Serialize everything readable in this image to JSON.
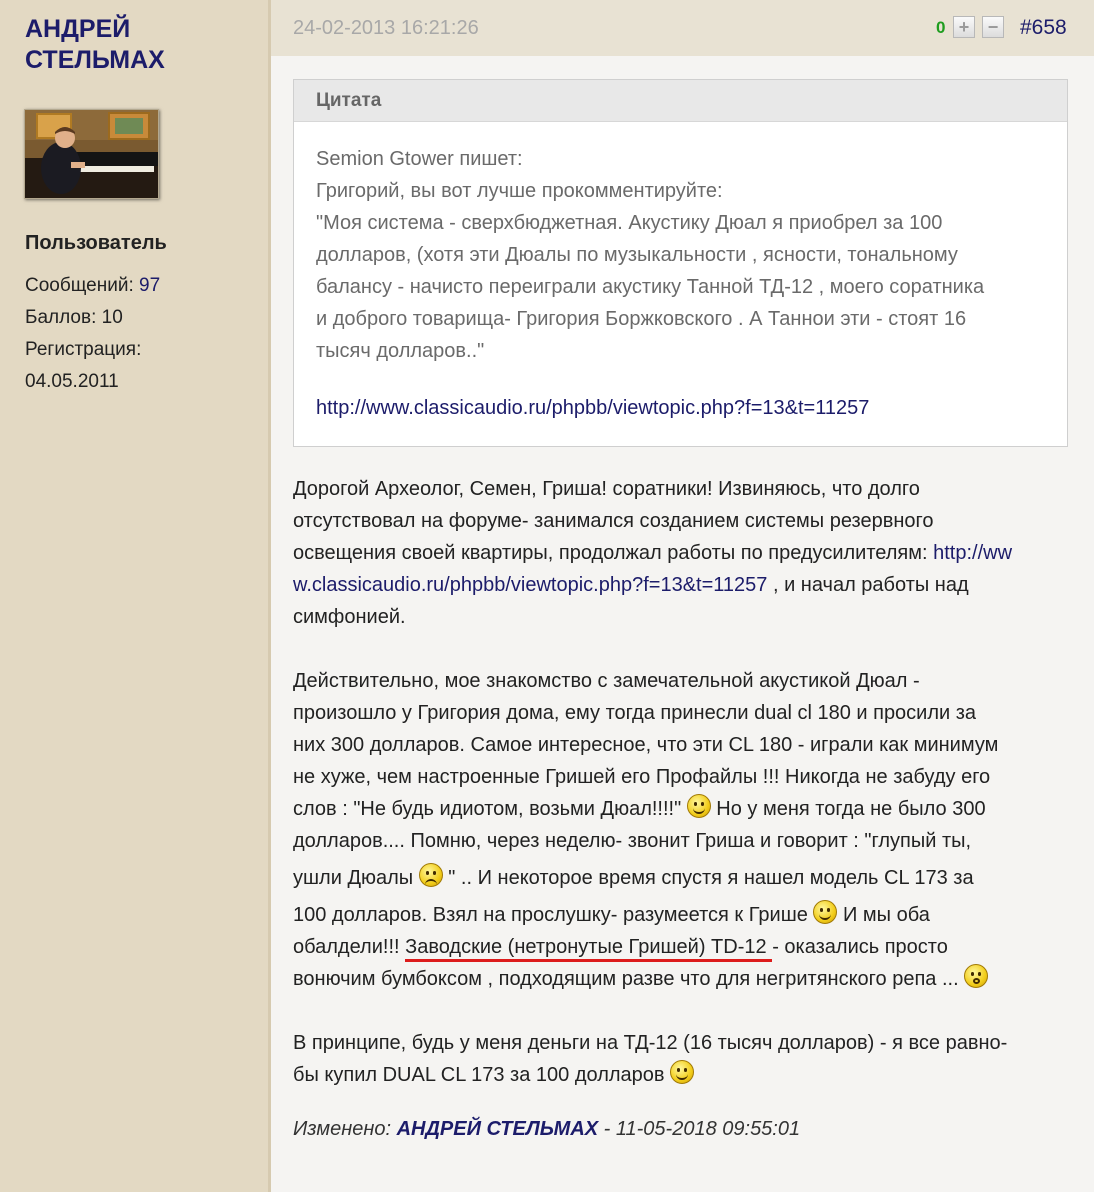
{
  "user": {
    "name_line1": "АНДРЕЙ",
    "name_line2": "СТЕЛЬМАХ",
    "role": "Пользователь",
    "messages_label": "Сообщений:",
    "messages_count": "97",
    "points_label": "Баллов:",
    "points_value": "10",
    "registration_label": "Регистрация:",
    "registration_date": "04.05.2011"
  },
  "post": {
    "date": "24-02-2013 16:21:26",
    "rating": "0",
    "plus_label": "+",
    "minus_label": "−",
    "number": "#658"
  },
  "quote": {
    "title": "Цитата",
    "lines": [
      "Semion Gtower пишет:",
      "Григорий, вы вот лучше прокомментируйте:",
      "\"Моя система - сверхбюджетная. Акустику Дюал я приобрел за 100",
      "долларов, (хотя эти Дюалы по музыкальности , ясности, тональному",
      "балансу - начисто переиграли акустику Танной ТД-12 , моего соратника",
      "и доброго товарища- Григория Боржковского . А Таннои эти - стоят 16",
      "тысяч долларов..\""
    ],
    "link": "http://www.classicaudio.ru/phpbb/viewtopic.php?f=13&t=11257"
  },
  "body": {
    "p1_line1": "Дорогой Археолог, Семен, Гриша! соратники! Извиняюсь, что долго",
    "p1_line2": "отсутствовал на форуме- занимался созданием системы резервного",
    "p1_line3_text": "освещения своей квартиры, продолжал работы по предусилителям: ",
    "p1_link_part1": "http://ww",
    "p1_link_part2": "w.classicaudio.ru/phpbb/viewtopic.php?f=13&t=11257",
    "p1_line4_rest": " , и начал работы над",
    "p1_line5": "симфонией.",
    "p2_line1": "Действительно, мое знакомство с замечательной акустикой Дюал -",
    "p2_line2": "произошло у Григория дома, ему тогда принесли dual cl 180 и просили за",
    "p2_line3": "них 300 долларов.  Самое интересное, что эти  CL 180 - играли как минимум",
    "p2_line4": "не хуже, чем настроенные Гришей  его Профайлы !!!  Никогда не забуду его",
    "p2_line5a": "слов : \"Не будь идиотом, возьми Дюал!!!!\" ",
    "p2_line5b": " Но у меня тогда не было 300",
    "p2_line6": "долларов.... Помню, через неделю- звонит Гриша и говорит : \"глупый ты,",
    "p2_line7a": "ушли Дюалы ",
    "p2_line7b": "   \" ..  И некоторое время спустя я нашел модель CL 173 за",
    "p2_line8a": "100 долларов. Взял на прослушку- разумеется к Грише ",
    "p2_line8b": " И мы оба",
    "p2_line9a": "обалдели!!!  ",
    "p2_line9_underlined": "Заводские (нетронутые Гришей) TD-12 ",
    "p2_line9b": "- оказались просто",
    "p2_line10": "вонючим бумбоксом , подходящим разве что для негритянского репа ... ",
    "p3_line1": "В принципе, будь у меня деньги на ТД-12  (16 тысяч долларов) - я все равно-",
    "p3_line2": "бы купил DUAL CL 173 за 100 долларов "
  },
  "edited": {
    "label": "Изменено: ",
    "author": "АНДРЕЙ СТЕЛЬМАХ",
    "datetime": " - 11-05-2018 09:55:01"
  },
  "icons": {
    "smiley_grin": "grin-smiley-icon",
    "smiley_sad": "sad-smiley-icon",
    "smiley_wink": "wink-smiley-icon",
    "smiley_shock": "shocked-smiley-icon"
  },
  "colors": {
    "sidebar_bg": "#e3d9c3",
    "header_bg": "#e8e2d3",
    "link": "#1c1c6a",
    "rating_positive": "#1f9d1f",
    "underline": "#dd1c1c"
  }
}
